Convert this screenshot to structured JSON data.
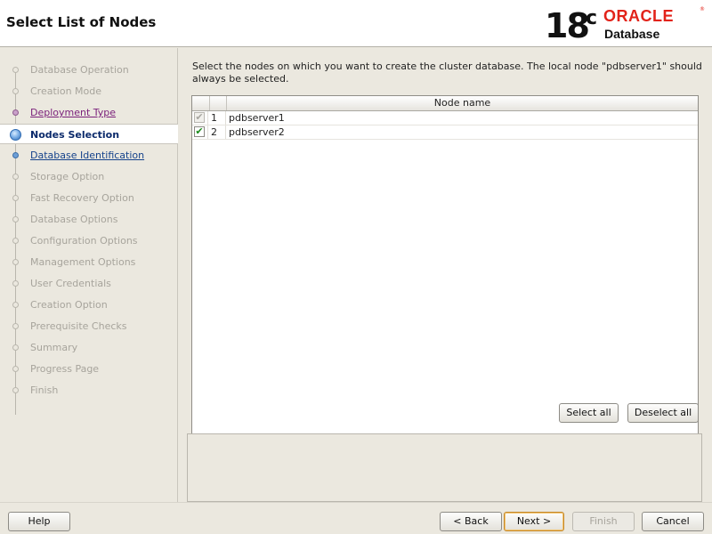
{
  "header": {
    "title": "Select List of Nodes",
    "logo": {
      "version": "18",
      "version_suffix": "c",
      "brand": "ORACLE",
      "registered": "®",
      "product": "Database"
    }
  },
  "sidebar": {
    "items": [
      {
        "label": "Database Operation",
        "state": "disabled"
      },
      {
        "label": "Creation Mode",
        "state": "disabled"
      },
      {
        "label": "Deployment Type",
        "state": "visited"
      },
      {
        "label": "Nodes Selection",
        "state": "current"
      },
      {
        "label": "Database Identification",
        "state": "next"
      },
      {
        "label": "Storage Option",
        "state": "disabled"
      },
      {
        "label": "Fast Recovery Option",
        "state": "disabled"
      },
      {
        "label": "Database Options",
        "state": "disabled"
      },
      {
        "label": "Configuration Options",
        "state": "disabled"
      },
      {
        "label": "Management Options",
        "state": "disabled"
      },
      {
        "label": "User Credentials",
        "state": "disabled"
      },
      {
        "label": "Creation Option",
        "state": "disabled"
      },
      {
        "label": "Prerequisite Checks",
        "state": "disabled"
      },
      {
        "label": "Summary",
        "state": "disabled"
      },
      {
        "label": "Progress Page",
        "state": "disabled"
      },
      {
        "label": "Finish",
        "state": "disabled"
      }
    ]
  },
  "main": {
    "description": "Select the nodes on which you want to create the cluster database. The local node \"pdbserver1\" should always be selected.",
    "table": {
      "columns": [
        "",
        "",
        "Node name"
      ],
      "rows": [
        {
          "index": "1",
          "node": "pdbserver1",
          "checked": true,
          "enabled": false
        },
        {
          "index": "2",
          "node": "pdbserver2",
          "checked": true,
          "enabled": true
        }
      ]
    },
    "select_all_label": "Select all",
    "deselect_all_label": "Deselect all"
  },
  "footer": {
    "help_label": "Help",
    "back_label": "< Back",
    "next_label": "Next >",
    "finish_label": "Finish",
    "cancel_label": "Cancel"
  },
  "colors": {
    "brand_red": "#e2231a",
    "visited_link": "#7a1f7a",
    "next_link": "#15428b",
    "check_green": "#1a8a1a"
  }
}
